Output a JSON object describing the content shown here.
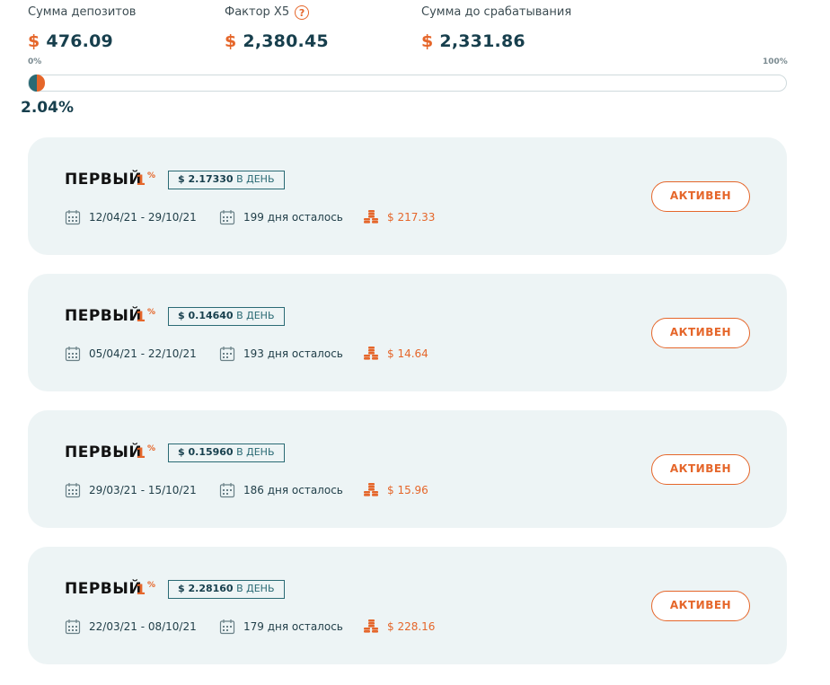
{
  "stats": {
    "deposits": {
      "label": "Сумма депозитов",
      "currency": "$",
      "value": "476.09"
    },
    "factor": {
      "label": "Фактор X5",
      "help_glyph": "?",
      "currency": "$",
      "value": "2,380.45"
    },
    "remaining": {
      "label": "Сумма до срабатывания",
      "currency": "$",
      "value": "2,331.86"
    }
  },
  "progress": {
    "min_label": "0%",
    "max_label": "100%",
    "value_label": "2.04%",
    "fraction": 0.0204
  },
  "colors": {
    "accent": "#e5662a",
    "teal": "#2a6a74",
    "card_bg": "#edf4f5"
  },
  "icons": {
    "date": "calendar-icon",
    "days": "calendar-icon",
    "profit": "coins-icon"
  },
  "deposits": [
    {
      "title": "ПЕРВЫЙ",
      "rate": "1",
      "rate_sym": "%",
      "daily_amount": "$ 2.17330",
      "daily_unit": "В ДЕНЬ",
      "dates": "12/04/21 - 29/10/21",
      "days_left": "199 дня осталось",
      "profit": "$ 217.33",
      "status": "АКТИВЕН"
    },
    {
      "title": "ПЕРВЫЙ",
      "rate": "1",
      "rate_sym": "%",
      "daily_amount": "$ 0.14640",
      "daily_unit": "В ДЕНЬ",
      "dates": "05/04/21 - 22/10/21",
      "days_left": "193 дня осталось",
      "profit": "$ 14.64",
      "status": "АКТИВЕН"
    },
    {
      "title": "ПЕРВЫЙ",
      "rate": "1",
      "rate_sym": "%",
      "daily_amount": "$ 0.15960",
      "daily_unit": "В ДЕНЬ",
      "dates": "29/03/21 - 15/10/21",
      "days_left": "186 дня осталось",
      "profit": "$ 15.96",
      "status": "АКТИВЕН"
    },
    {
      "title": "ПЕРВЫЙ",
      "rate": "1",
      "rate_sym": "%",
      "daily_amount": "$ 2.28160",
      "daily_unit": "В ДЕНЬ",
      "dates": "22/03/21 - 08/10/21",
      "days_left": "179 дня осталось",
      "profit": "$ 228.16",
      "status": "АКТИВЕН"
    }
  ]
}
